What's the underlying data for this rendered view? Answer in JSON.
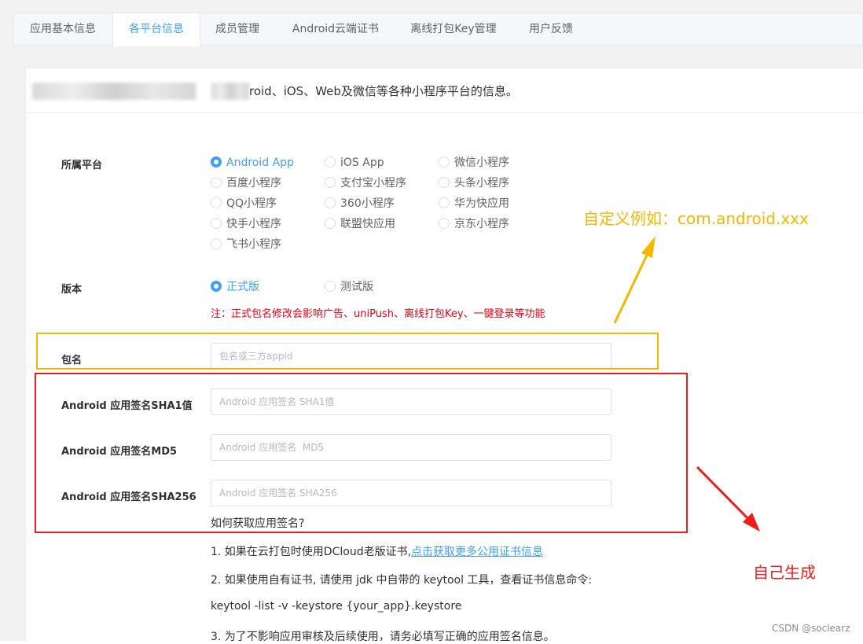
{
  "tabs": [
    {
      "label": "应用基本信息",
      "active": false
    },
    {
      "label": "各平台信息",
      "active": true
    },
    {
      "label": "成员管理",
      "active": false
    },
    {
      "label": "Android云端证书",
      "active": false
    },
    {
      "label": "离线打包Key管理",
      "active": false
    },
    {
      "label": "用户反馈",
      "active": false
    }
  ],
  "intro": {
    "visible_text": "roid、iOS、Web及微信等各种小程序平台的信息。"
  },
  "platform": {
    "label": "所属平台",
    "options": [
      {
        "label": "Android App",
        "checked": true
      },
      {
        "label": "iOS App",
        "checked": false
      },
      {
        "label": "微信小程序",
        "checked": false
      },
      {
        "label": "百度小程序",
        "checked": false
      },
      {
        "label": "支付宝小程序",
        "checked": false
      },
      {
        "label": "头条小程序",
        "checked": false
      },
      {
        "label": "QQ小程序",
        "checked": false
      },
      {
        "label": "360小程序",
        "checked": false
      },
      {
        "label": "华为快应用",
        "checked": false
      },
      {
        "label": "快手小程序",
        "checked": false
      },
      {
        "label": "联盟快应用",
        "checked": false
      },
      {
        "label": "京东小程序",
        "checked": false
      },
      {
        "label": "飞书小程序",
        "checked": false
      }
    ]
  },
  "version": {
    "label": "版本",
    "options": [
      {
        "label": "正式版",
        "checked": true
      },
      {
        "label": "测试版",
        "checked": false
      }
    ],
    "note": "注：正式包名修改会影响广告、uniPush、离线打包Key、一键登录等功能"
  },
  "fields": [
    {
      "label": "包名",
      "placeholder": "包名或三方appid",
      "value": ""
    },
    {
      "label": "Android 应用签名SHA1值",
      "placeholder": "Android 应用签名 SHA1值",
      "value": ""
    },
    {
      "label": "Android 应用签名MD5",
      "placeholder": "Android 应用签名  MD5",
      "value": ""
    },
    {
      "label": "Android 应用签名SHA256",
      "placeholder": "Android 应用签名 SHA256",
      "value": ""
    }
  ],
  "help": {
    "question": "如何获取应用签名?",
    "line1_prefix": "1. 如果在云打包时使用DCloud老版证书,",
    "line1_link": "点击获取更多公用证书信息",
    "line2": "2. 如果使用自有证书, 请使用 jdk 中自带的 keytool 工具，查看证书信息命令:",
    "line3": "keytool -list -v -keystore {your_app}.keystore",
    "line4": "3. 为了不影响应用审核及后续使用，请务必填写正确的应用签名信息。"
  },
  "annotations": {
    "yellow_text": "自定义例如：com.android.xxx",
    "red_text": "自己生成",
    "yellow_color": "#f5b800",
    "red_color": "#ee1d1d"
  },
  "watermark": "CSDN @soclearz",
  "colors": {
    "accent": "#409eff",
    "warning_note": "#e60012"
  }
}
